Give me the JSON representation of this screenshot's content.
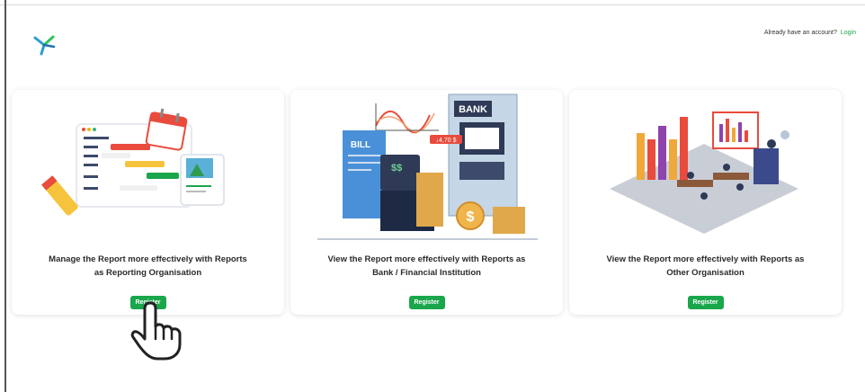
{
  "header": {
    "account_prompt": "Already have an account?",
    "login_label": "Login",
    "accent_color": "#1aa64b"
  },
  "cards": [
    {
      "title_line1": "Manage the Report more effectively with Reports",
      "title_line2": "as Reporting Organisation",
      "button_label": "Register",
      "illustration": "report-planning-illustration"
    },
    {
      "title_line1": "View the Report more effectively with Reports as",
      "title_line2": "Bank / Financial Institution",
      "button_label": "Register",
      "illustration": "bank-finance-illustration"
    },
    {
      "title_line1": "View the Report more effectively with Reports as",
      "title_line2": "Other Organisation",
      "button_label": "Register",
      "illustration": "meeting-presentation-illustration"
    }
  ],
  "illustration_text": {
    "bill": "BILL",
    "bank": "BANK",
    "price_tag": "↓4,70 $",
    "dollars": "$$"
  },
  "cursor": "hand-pointer-icon"
}
